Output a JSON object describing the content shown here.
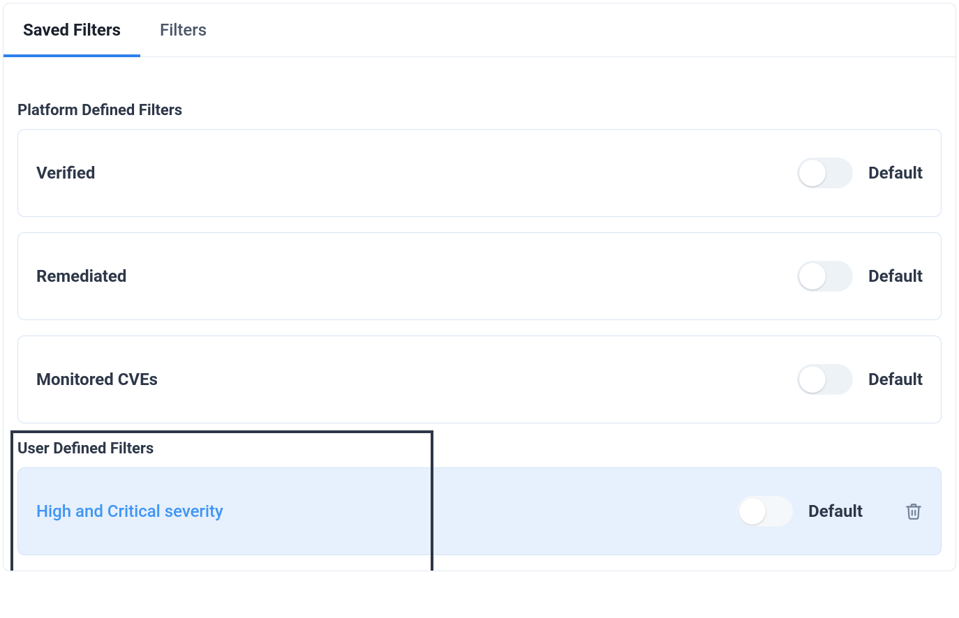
{
  "tabs": {
    "saved_filters": "Saved Filters",
    "filters": "Filters"
  },
  "sections": {
    "platform": {
      "heading": "Platform Defined Filters",
      "items": [
        {
          "name": "Verified",
          "default_label": "Default"
        },
        {
          "name": "Remediated",
          "default_label": "Default"
        },
        {
          "name": "Monitored CVEs",
          "default_label": "Default"
        }
      ]
    },
    "user": {
      "heading": "User Defined Filters",
      "items": [
        {
          "name": "High and Critical severity",
          "default_label": "Default"
        }
      ]
    }
  }
}
